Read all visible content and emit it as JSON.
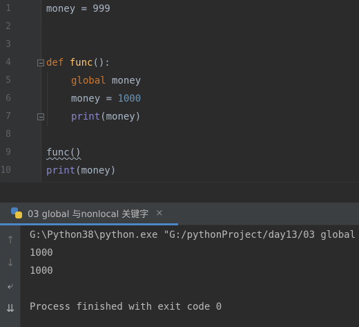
{
  "editor": {
    "lines": [
      {
        "num": "1",
        "text": "money = 999"
      },
      {
        "num": "2",
        "text": ""
      },
      {
        "num": "3",
        "text": ""
      },
      {
        "num": "4",
        "kw": "def",
        "fn": "func",
        "rest": "():"
      },
      {
        "num": "5",
        "kw": "global",
        "rest": " money"
      },
      {
        "num": "6",
        "var": "money",
        "op": " = ",
        "numval": "1000"
      },
      {
        "num": "7",
        "builtin": "print",
        "rest": "(money)"
      },
      {
        "num": "8",
        "text": ""
      },
      {
        "num": "9",
        "text": "func()"
      },
      {
        "num": "10",
        "builtin": "print",
        "rest": "(money)"
      }
    ]
  },
  "run": {
    "tab_label": "03 global 与nonlocal 关键字",
    "close_icon": "×",
    "console": [
      "G:\\Python38\\python.exe \"G:/pythonProject/day13/03 global",
      "1000",
      "1000",
      "",
      "Process finished with exit code 0"
    ]
  },
  "toolbar": {
    "up": "↑",
    "down": "↓",
    "wrap": "⤶",
    "scroll_end": "⇊"
  }
}
